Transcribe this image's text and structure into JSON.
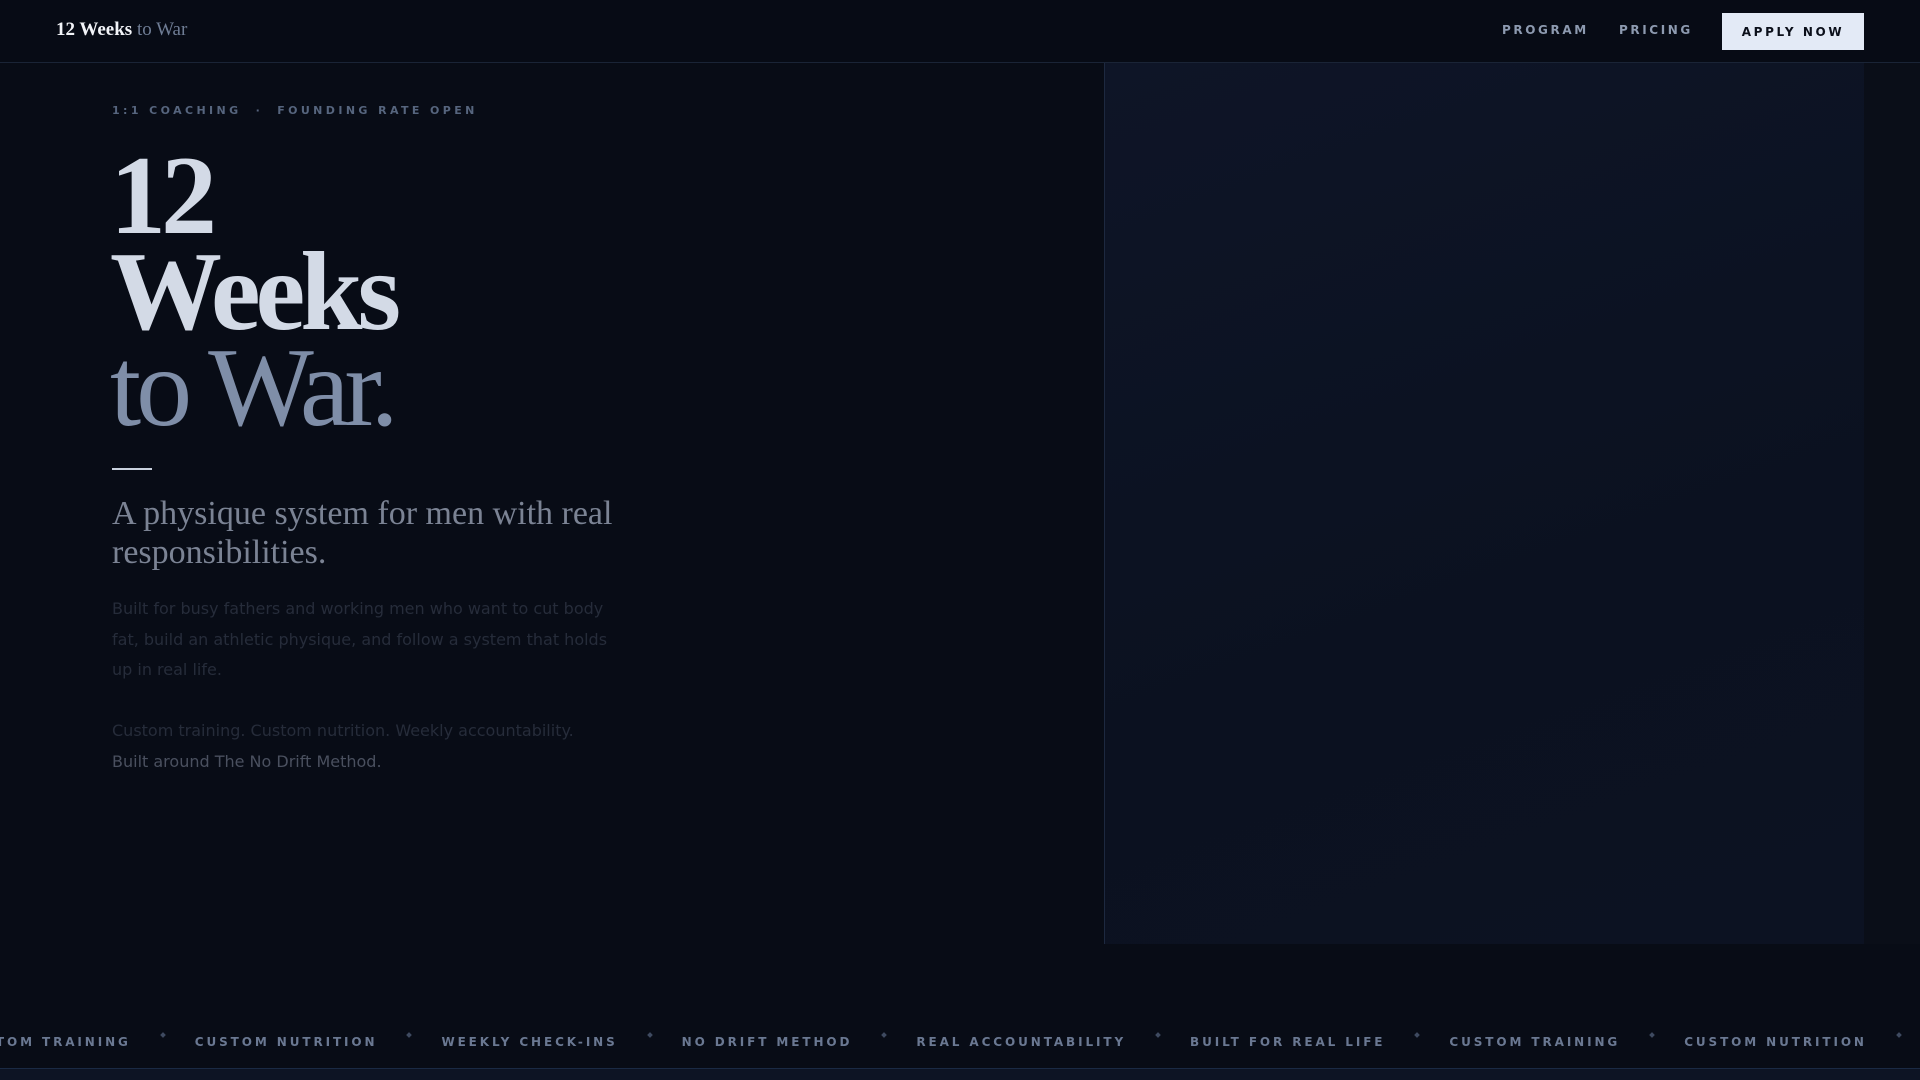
{
  "nav": {
    "logo_bold": "12 Weeks",
    "logo_light": "to War",
    "links": [
      "PROGRAM",
      "PRICING"
    ],
    "cta": "APPLY NOW"
  },
  "hero": {
    "eyebrow_left": "1:1 COACHING",
    "eyebrow_sep": "·",
    "eyebrow_right": "FOUNDING RATE OPEN",
    "headline": [
      "12",
      "Weeks",
      "to War."
    ],
    "subheadline": "A physique system for men with real responsibilities.",
    "body": "Built for busy fathers and working men who want to cut body fat, build an athletic physique, and follow a system that holds up in real life.",
    "features": "Custom training. Custom nutrition. Weekly accountability.",
    "method": "Built around The No Drift Method."
  },
  "ticker": {
    "items": [
      "CUSTOM TRAINING",
      "CUSTOM NUTRITION",
      "WEEKLY CHECK-INS",
      "NO DRIFT METHOD",
      "REAL ACCOUNTABILITY",
      "BUILT FOR REAL LIFE",
      "CUSTOM TRAINING",
      "CUSTOM NUTRITION",
      "WEEKLY CHECK-INS"
    ]
  },
  "colors": {
    "background": "#080c16",
    "accent": "#e3eaf6",
    "headline": "#d3dae6",
    "headline_muted": "#7f8ea8"
  }
}
